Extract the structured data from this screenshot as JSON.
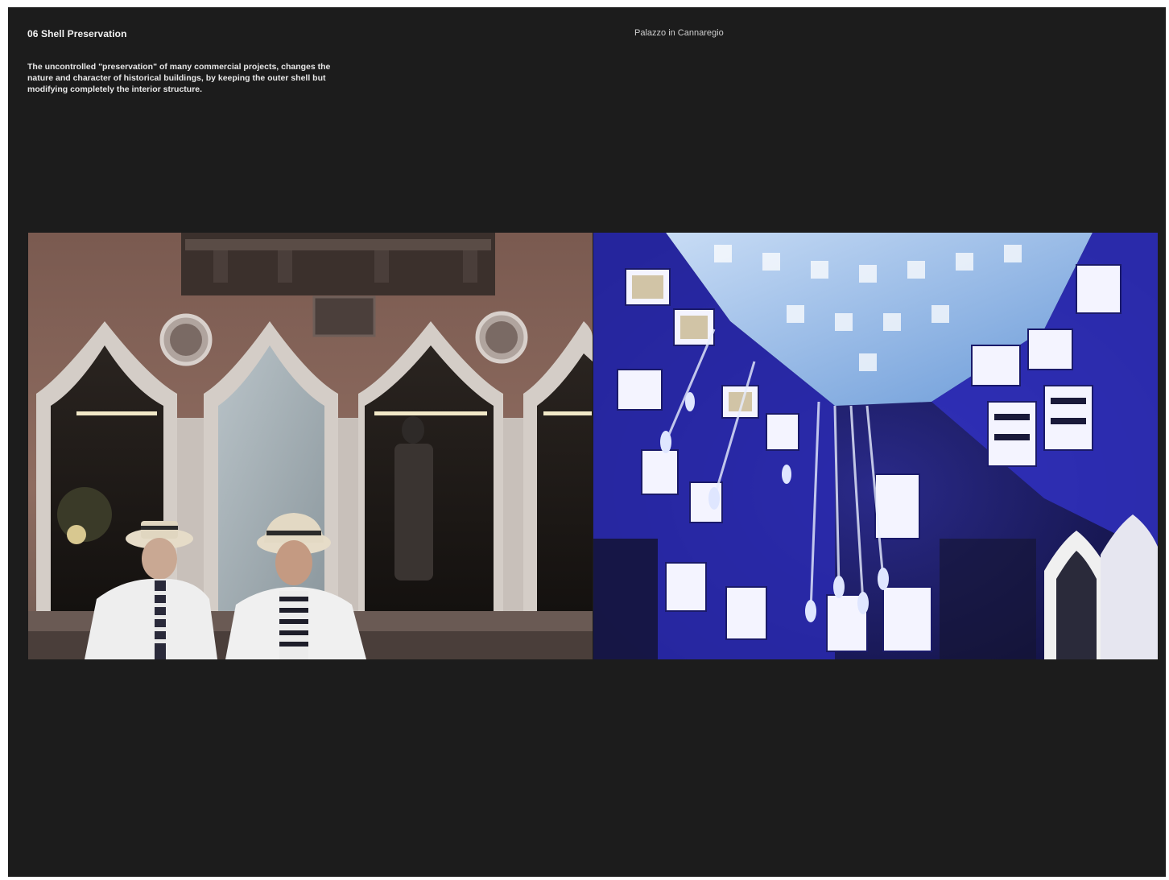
{
  "page": {
    "heading": "06 Shell Preservation",
    "body": "The uncontrolled \"preservation\" of many commercial projects, changes the nature and character of historical buildings, by keeping the outer shell but modifying completely the interior structure.",
    "caption": "Palazzo in Cannaregio"
  },
  "images": {
    "left": {
      "subject": "Venetian gothic palazzo facade with shop windows and two men in straw boater hats"
    },
    "right": {
      "subject": "Interior ceiling with blue mirrored panels and crystal chandeliers"
    }
  },
  "colors": {
    "background": "#1c1c1c",
    "text": "#f2f2f2"
  }
}
